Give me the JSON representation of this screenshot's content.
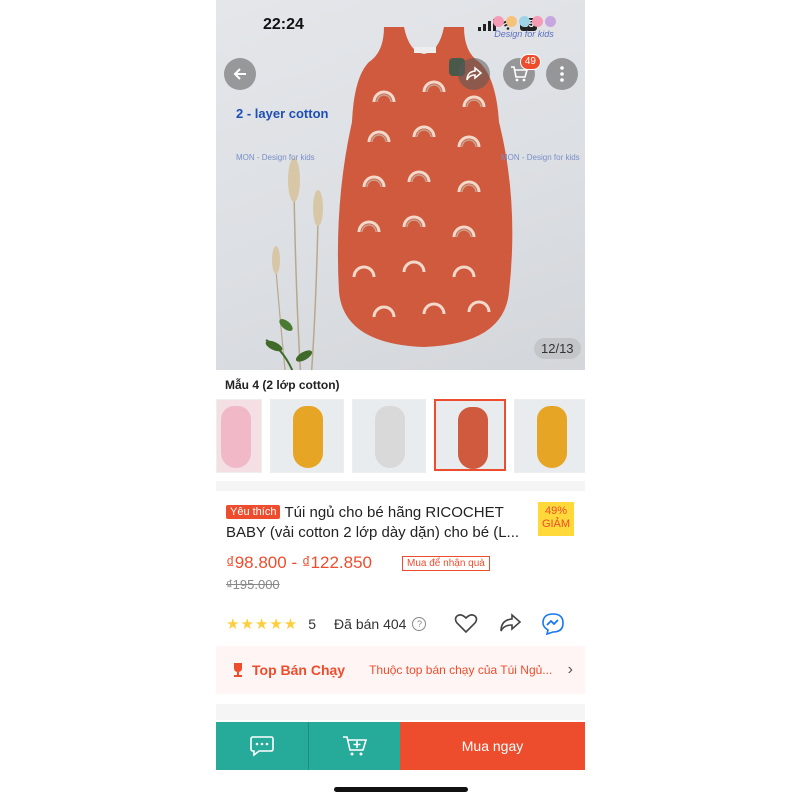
{
  "status_bar": {
    "time": "22:24",
    "battery": "55"
  },
  "brand": {
    "text": "Design for kids"
  },
  "header": {
    "cart_count": "49"
  },
  "hero": {
    "layer_label": "2 - layer cotton",
    "watermark": "MON - Design for kids",
    "counter": "12/13"
  },
  "variant": {
    "name": "Mẫu 4 (2 lớp cotton)"
  },
  "product": {
    "favorite_tag": "Yêu thích",
    "title": "Túi ngủ cho bé hãng RICOCHET BABY (vải cotton 2 lớp dày dặn) cho bé (L...",
    "discount_percent": "49%",
    "discount_label": "GIẢM",
    "price_range": "₫98.800 - ₫122.850",
    "gift_tag": "Mua để nhận quà",
    "original_price": "₫195.000",
    "rating": "5",
    "sold": "Đã bán 404"
  },
  "top_selling": {
    "title": "Top Bán Chạy",
    "desc": "Thuộc top bán chạy của Túi Ngủ..."
  },
  "bottom_bar": {
    "buy_label": "Mua ngay"
  },
  "colors": {
    "accent": "#ee4d2d",
    "teal": "#26aa99",
    "rating": "#ffce3d"
  }
}
